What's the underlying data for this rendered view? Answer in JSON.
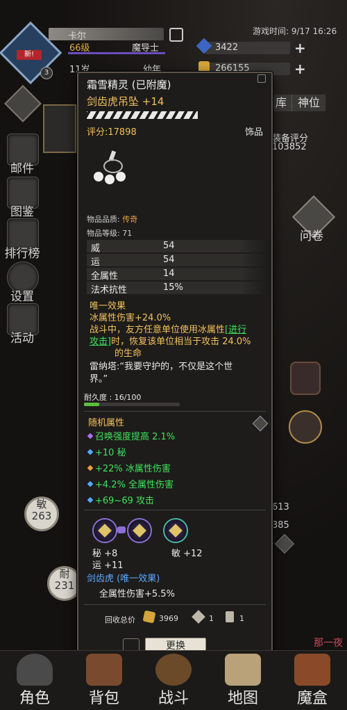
{
  "header": {
    "player_name": "卡尔",
    "level": "66级",
    "class_name": "魔导士",
    "age": "11岁",
    "age_stage": "幼年",
    "game_time": "游戏时间: 9/17 16:26",
    "gems": "3422",
    "gold": "266155",
    "new_badge": "新!",
    "rank_badge": "3"
  },
  "top_tabs": [
    "库",
    "神位"
  ],
  "equip_score": {
    "label": "装备评分",
    "value": "103852"
  },
  "sidebar": [
    {
      "label": "邮件",
      "icon": "mail-icon"
    },
    {
      "label": "图鉴",
      "icon": "book-icon"
    },
    {
      "label": "排行榜",
      "icon": "ranking-icon"
    },
    {
      "label": "设置",
      "icon": "gear-icon"
    },
    {
      "label": "活动",
      "icon": "event-icon"
    }
  ],
  "right_side": {
    "survey_label": "问卷",
    "stat_613": "613",
    "stat_385": "385",
    "nayiye": "那一夜"
  },
  "left_badges": {
    "min_label": "敏",
    "min_value": "263",
    "nai_label": "耐",
    "nai_value": "231"
  },
  "item": {
    "title": "霜雪精灵 (已附魔)",
    "name": "剑齿虎吊坠 +14",
    "score": "评分:17898",
    "slot": "饰品",
    "quality_label": "物品品质:",
    "quality_value": "传奇",
    "item_level": "物品等级: 71",
    "stats": [
      {
        "k": "威",
        "v": "54"
      },
      {
        "k": "运",
        "v": "54"
      },
      {
        "k": "全属性",
        "v": "14"
      },
      {
        "k": "法术抗性",
        "v": "15%"
      }
    ],
    "unique_header": "唯一效果",
    "unique_line1": "冰属性伤害+24.0%",
    "unique_line2_a": "战斗中，友方任意单位使用冰属性",
    "unique_line2_link": "[进行",
    "unique_line3_link": "攻击]",
    "unique_line3_b": "时，恢复该单位相当于攻击 24.0%",
    "unique_line4": "的生命",
    "quote_line1": "雷纳塔:“我要守护的，不仅是这个世",
    "quote_line2": "界。”",
    "durability": "耐久度 : 16/100",
    "durability_fraction": 0.16,
    "random_header": "随机属性",
    "random_attrs": [
      {
        "text": "召唤强度提高 2.1%",
        "color": "#b070ff"
      },
      {
        "text": "+10 秘",
        "color": "#5aa9ff"
      },
      {
        "text": "+22% 冰属性伤害",
        "color": "#f0a040"
      },
      {
        "text": "+4.2% 全属性伤害",
        "color": "#5aa9ff"
      },
      {
        "text": "+69~69 攻击",
        "color": "#5aa9ff"
      }
    ],
    "gem_stats": {
      "a1": "秘 +8",
      "a2": "运 +11",
      "b1": "敏 +12"
    },
    "set_name": "剑齿虎 (唯一效果)",
    "set_effect": "全属性伤害+5.5%",
    "recycle_label": "回收总价",
    "recycle_gold": "3969",
    "recycle_mat1": "1",
    "recycle_mat2": "1",
    "replace_button": "更换"
  },
  "bottom_nav": [
    {
      "label": "角色",
      "icon": "helmet-icon"
    },
    {
      "label": "背包",
      "icon": "backpack-icon"
    },
    {
      "label": "战斗",
      "icon": "sword-shield-icon"
    },
    {
      "label": "地图",
      "icon": "scroll-map-icon"
    },
    {
      "label": "魔盒",
      "icon": "magic-box-icon"
    }
  ]
}
